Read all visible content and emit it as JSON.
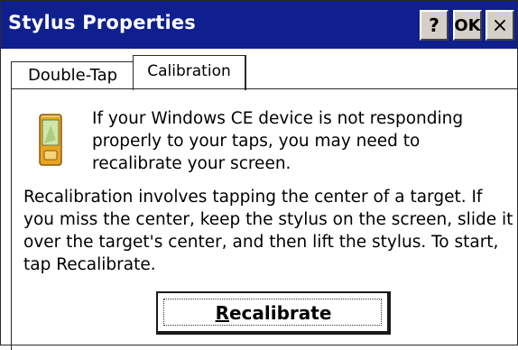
{
  "window": {
    "title": "Stylus Properties",
    "help_label": "?",
    "ok_label": "OK",
    "close_label": "×",
    "title_color": "#0f1f8d"
  },
  "tabs": [
    {
      "label": "Double-Tap",
      "active": false
    },
    {
      "label": "Calibration",
      "active": true
    }
  ],
  "content": {
    "device_icon": "pda-device-icon",
    "intro_text": "If your Windows CE device is not responding properly to your taps, you may need to recalibrate your screen.",
    "instructions_text": "Recalibration involves tapping the center of a target. If you miss the center, keep the stylus on the screen, slide it over the target's center, and then lift the stylus. To start, tap Recalibrate.",
    "recalibrate_button": {
      "mnemonic": "R",
      "rest": "ecalibrate"
    }
  }
}
